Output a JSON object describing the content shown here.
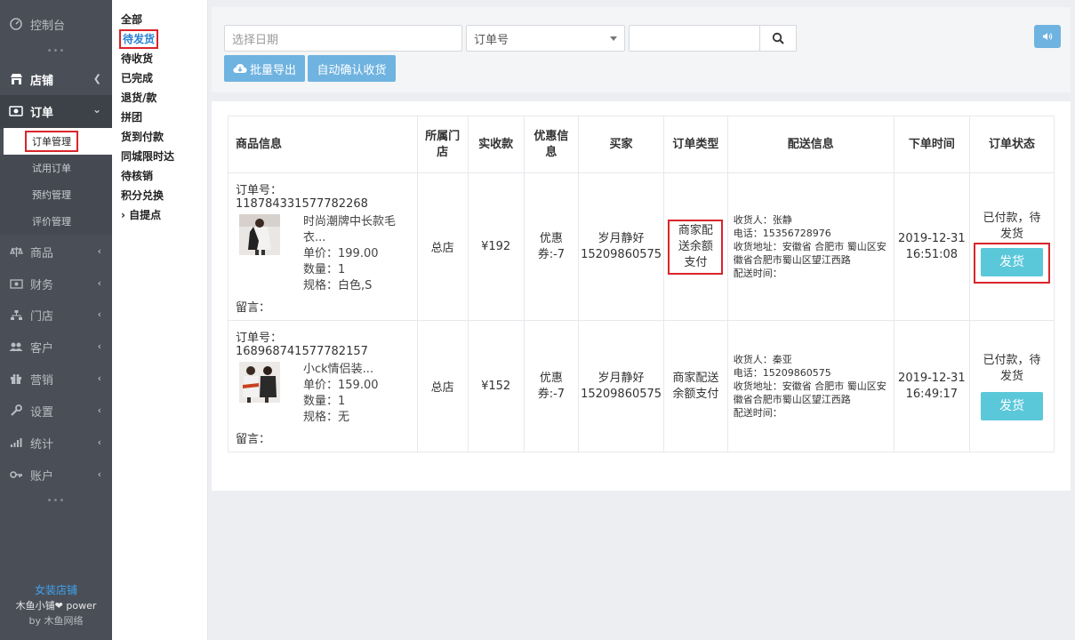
{
  "sidebar": {
    "dashboard": "控制台",
    "shop": "店铺",
    "order": "订单",
    "order_sub": [
      "订单管理",
      "试用订单",
      "预约管理",
      "评价管理"
    ],
    "goods": "商品",
    "finance": "财务",
    "store": "门店",
    "customer": "客户",
    "marketing": "营销",
    "settings": "设置",
    "stats": "统计",
    "account": "账户",
    "footer": {
      "shop_name": "女装店铺",
      "power": "木鱼小铺❤ power",
      "by": "by 木鱼网络"
    }
  },
  "status_filters": [
    "全部",
    "待发货",
    "待收货",
    "已完成",
    "退货/款",
    "拼团",
    "货到付款",
    "同城限时达",
    "待核销",
    "积分兑换",
    "› 自提点"
  ],
  "toolbar": {
    "date_placeholder": "选择日期",
    "search_type": "订单号",
    "search_value": "",
    "export_label": "批量导出",
    "auto_confirm_label": "自动确认收货"
  },
  "table": {
    "headers": [
      "商品信息",
      "所属门店",
      "实收款",
      "优惠信息",
      "买家",
      "订单类型",
      "配送信息",
      "下单时间",
      "订单状态"
    ],
    "rows": [
      {
        "order_no": "订单号：118784331577782268",
        "title_line1": "时尚潮牌中长款毛",
        "title_line2": "衣...",
        "price": "单价：199.00",
        "qty": "数量：1",
        "spec": "规格：白色,S",
        "memo": "留言：",
        "store": "总店",
        "paid": "¥192",
        "coupon": "优惠券:-7",
        "buyer_name": "岁月静好",
        "buyer_phone": "15209860575",
        "type": "商家配送余额支付",
        "receiver": "收货人：张静",
        "phone": "电话：15356728976",
        "address": "收货地址：安徽省 合肥市 蜀山区安徽省合肥市蜀山区望江西路",
        "delivery_time": "配送时间：",
        "order_date": "2019-12-31",
        "order_time": "16:51:08",
        "status": "已付款，待发货",
        "action": "发货"
      },
      {
        "order_no": "订单号：168968741577782157",
        "title_line1": "小ck情侣装...",
        "title_line2": "",
        "price": "单价：159.00",
        "qty": "数量：1",
        "spec": "规格：无",
        "memo": "留言：",
        "store": "总店",
        "paid": "¥152",
        "coupon": "优惠券:-7",
        "buyer_name": "岁月静好",
        "buyer_phone": "15209860575",
        "type": "商家配送余额支付",
        "receiver": "收货人：秦亚",
        "phone": "电话：15209860575",
        "address": "收货地址：安徽省 合肥市 蜀山区安徽省合肥市蜀山区望江西路",
        "delivery_time": "配送时间：",
        "order_date": "2019-12-31",
        "order_time": "16:49:17",
        "status": "已付款，待发货",
        "action": "发货"
      }
    ]
  }
}
